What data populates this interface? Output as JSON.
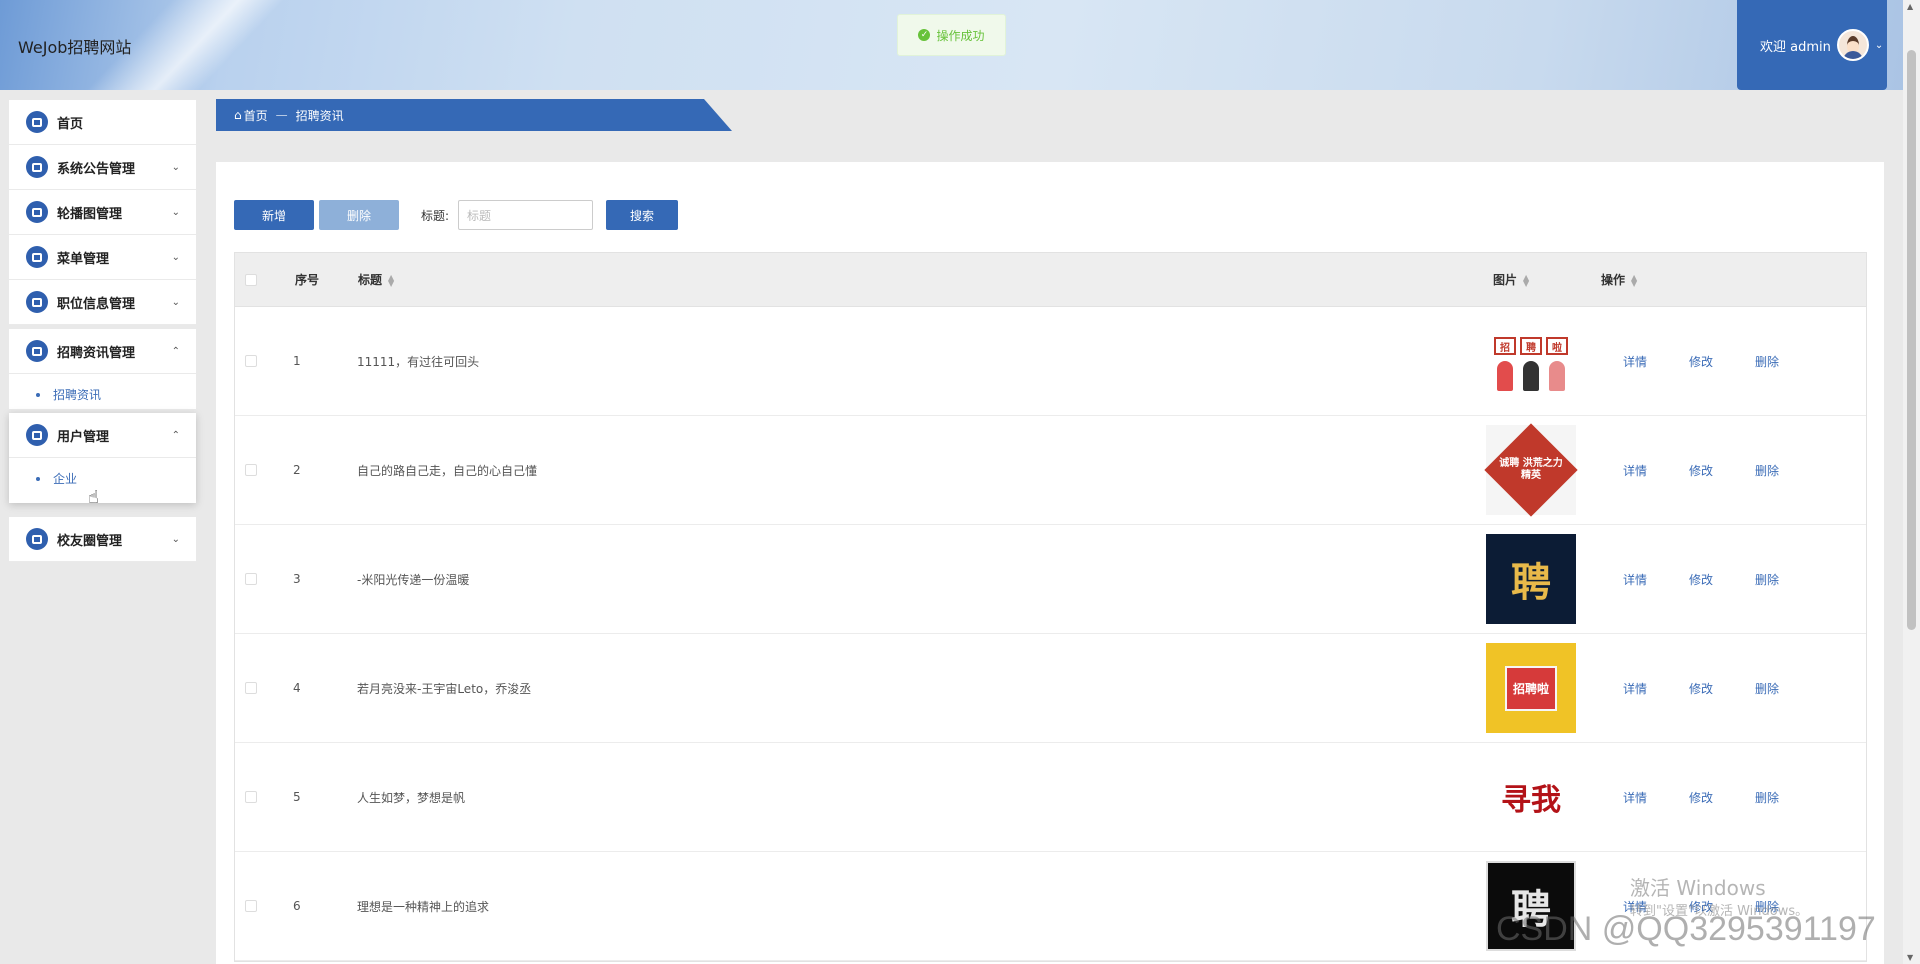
{
  "header": {
    "site_title": "WeJob招聘网站",
    "toast": "操作成功",
    "welcome": "欢迎 admin"
  },
  "sidebar": {
    "items": [
      {
        "label": "首页"
      },
      {
        "label": "系统公告管理"
      },
      {
        "label": "轮播图管理"
      },
      {
        "label": "菜单管理"
      },
      {
        "label": "职位信息管理"
      },
      {
        "label": "招聘资讯管理",
        "sub": "招聘资讯"
      },
      {
        "label": "用户管理",
        "sub": "企业"
      },
      {
        "label": "校友圈管理"
      }
    ]
  },
  "breadcrumb": {
    "home": "首页",
    "sep": "—",
    "current": "招聘资讯"
  },
  "toolbar": {
    "add": "新增",
    "delete": "删除",
    "title_label": "标题:",
    "title_placeholder": "标题",
    "search": "搜索"
  },
  "table": {
    "headers": {
      "no": "序号",
      "title": "标题",
      "image": "图片",
      "ops": "操作"
    },
    "ops": {
      "detail": "详情",
      "edit": "修改",
      "delete": "删除"
    },
    "rows": [
      {
        "no": "1",
        "title": "11111，有过往可回头"
      },
      {
        "no": "2",
        "title": "自己的路自己走，自己的心自己懂"
      },
      {
        "no": "3",
        "title": "-米阳光传递一份温暖"
      },
      {
        "no": "4",
        "title": "若月亮没来-王宇宙Leto，乔浚丞"
      },
      {
        "no": "5",
        "title": "人生如梦，梦想是帆"
      },
      {
        "no": "6",
        "title": "理想是一种精神上的追求"
      }
    ],
    "thumb_text": {
      "t1_signs": [
        "招",
        "聘",
        "啦"
      ],
      "t2": "诚聘 洪荒之力 精英",
      "t3": "聘",
      "t4": "招聘啦",
      "t5": "寻我",
      "t6": "聘"
    }
  },
  "watermark": {
    "line1": "激活 Windows",
    "line2": "转到\"设置\"以激活 Windows。",
    "csdn": "CSDN @QQ3295391197"
  },
  "colors": {
    "primary": "#3569b6",
    "link": "#3b6cb7",
    "success": "#67c23a"
  }
}
